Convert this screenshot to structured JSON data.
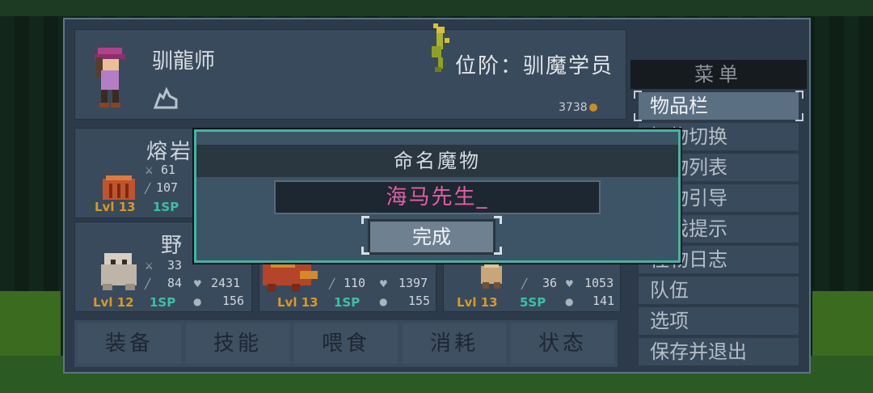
{
  "player": {
    "name": "驯龍师",
    "rank": "位阶：驯魔学员",
    "gold": "3738"
  },
  "monsters": [
    {
      "name": "熔岩",
      "lvl": "Lvl 13",
      "sp": "1SP",
      "atk": "61",
      "mag": "107"
    },
    {
      "name": "野",
      "lvl": "Lvl 12",
      "sp": "1SP",
      "atk": "33",
      "mag": "84",
      "hp": "2431",
      "mp": "156"
    },
    {
      "name": "",
      "lvl": "Lvl 13",
      "sp": "1SP",
      "atk": "",
      "mag": "110",
      "hp": "1397",
      "mp": "155"
    },
    {
      "name": "",
      "lvl": "Lvl 13",
      "sp": "5SP",
      "atk": "",
      "mag": "36",
      "hp": "1053",
      "mp": "141"
    }
  ],
  "tabs": [
    "装备",
    "技能",
    "喂食",
    "消耗",
    "状态"
  ],
  "menu": {
    "title": "菜单",
    "items": [
      "物品栏",
      "怪物切换",
      "怪物列表",
      "魔物引导",
      "游戏提示",
      "怪物日志",
      "队伍",
      "选项",
      "保存并退出"
    ]
  },
  "dialog": {
    "title": "命名魔物",
    "input_value": "海马先生_",
    "done_label": "完成"
  },
  "colors": {
    "accent": "#3fb7a5",
    "name_text": "#e25fa5",
    "level": "#d79a23",
    "sp": "#3bc0a8"
  }
}
